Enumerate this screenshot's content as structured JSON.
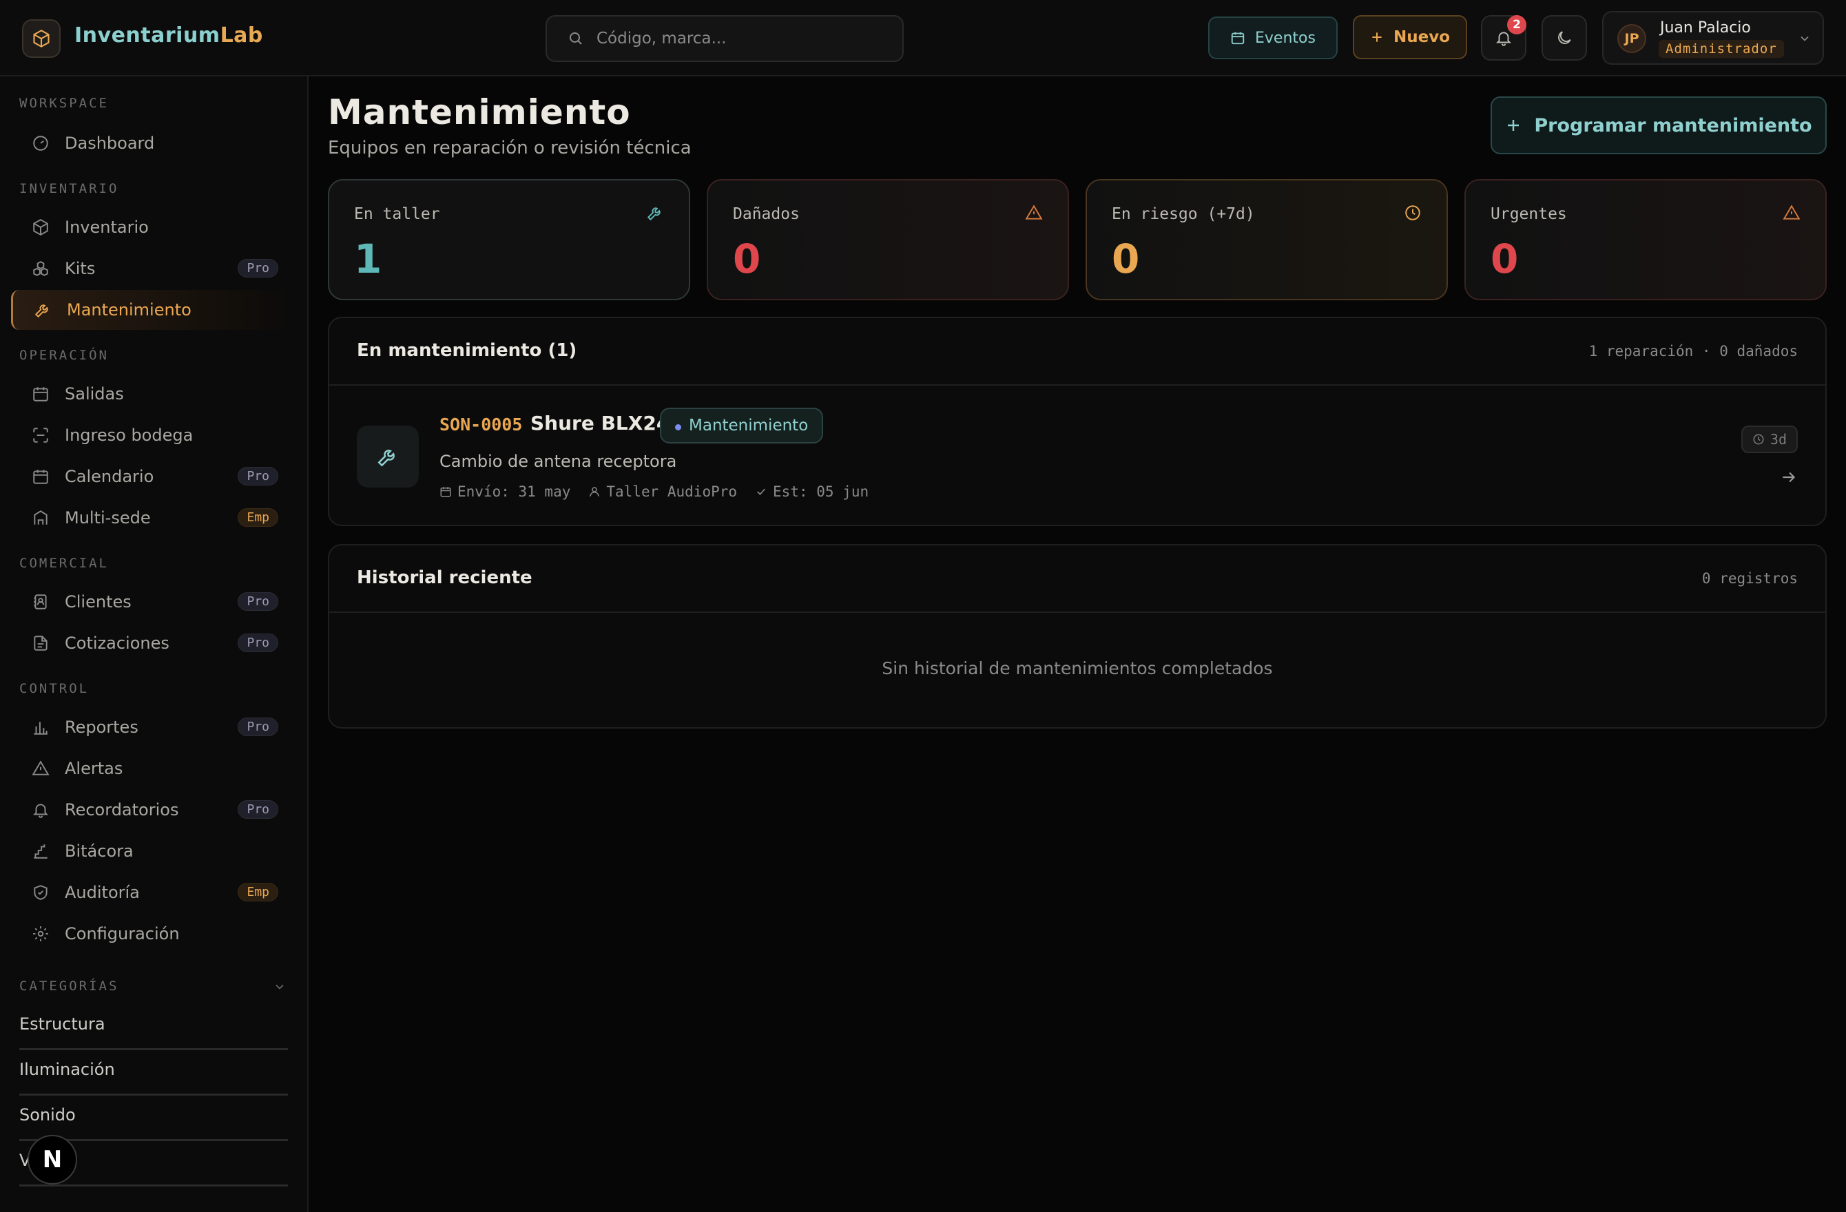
{
  "topbar": {
    "brand_part1": "Inventarium",
    "brand_part2": "Lab",
    "search_placeholder": "Código, marca...",
    "eventos_label": "Eventos",
    "nuevo_label": "Nuevo",
    "notification_count": "2",
    "user": {
      "initials": "JP",
      "name": "Juan Palacio",
      "role": "Administrador"
    }
  },
  "sidebar": {
    "sections": {
      "workspace": "WORKSPACE",
      "inventario": "INVENTARIO",
      "operacion": "OPERACIÓN",
      "comercial": "COMERCIAL",
      "control": "CONTROL",
      "categorias": "CATEGORÍAS"
    },
    "items": {
      "dashboard": "Dashboard",
      "inventario": "Inventario",
      "kits": "Kits",
      "mantenimiento": "Mantenimiento",
      "salidas": "Salidas",
      "ingreso": "Ingreso bodega",
      "calendario": "Calendario",
      "multisede": "Multi-sede",
      "clientes": "Clientes",
      "cotizaciones": "Cotizaciones",
      "reportes": "Reportes",
      "alertas": "Alertas",
      "recordatorios": "Recordatorios",
      "bitacora": "Bitácora",
      "auditoria": "Auditoría",
      "configuracion": "Configuración"
    },
    "badges": {
      "pro": "Pro",
      "emp": "Emp"
    },
    "categories": [
      "Estructura",
      "Iluminación",
      "Sonido",
      "V"
    ]
  },
  "main": {
    "title": "Mantenimiento",
    "subtitle": "Equipos en reparación o revisión técnica",
    "program_button": "Programar mantenimiento",
    "stats": [
      {
        "label": "En taller",
        "value": "1",
        "color": "#5fb8b8"
      },
      {
        "label": "Dañados",
        "value": "0",
        "color": "#e0474d"
      },
      {
        "label": "En riesgo (+7d)",
        "value": "0",
        "color": "#eaa752"
      },
      {
        "label": "Urgentes",
        "value": "0",
        "color": "#e0474d"
      }
    ],
    "maintenance_panel": {
      "title": "En mantenimiento (1)",
      "meta": "1 reparación · 0 dañados",
      "item": {
        "code": "SON-0005",
        "name": "Shure BLX24",
        "status": "Mantenimiento",
        "description": "Cambio de antena receptora",
        "sent": "Envío: 31 may",
        "workshop": "Taller AudioPro",
        "estimate": "Est: 05 jun",
        "age": "3d"
      }
    },
    "history_panel": {
      "title": "Historial reciente",
      "meta": "0 registros",
      "empty": "Sin historial de mantenimientos completados"
    }
  },
  "colors": {
    "accent_amber": "#eaa752",
    "accent_teal": "#8fd0cf",
    "danger": "#e0474d"
  }
}
